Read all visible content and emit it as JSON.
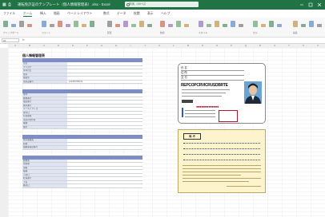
{
  "titlebar": {
    "autosave": "自動保存",
    "doc_title": "運転免許証のテンプレート（個人情報管理表）.xlsx - Excel",
    "search_placeholder": "検索（Alt+Q）"
  },
  "menu": {
    "items": [
      "ファイル",
      "ホーム",
      "挿入",
      "描画",
      "ページ レイアウト",
      "数式",
      "データ",
      "校閲",
      "表示",
      "ヘルプ"
    ],
    "active_index": 1
  },
  "ribbon": {
    "groups": [
      "クリップボード",
      "フォント",
      "配置",
      "数値",
      "スタイル",
      "セル",
      "編集"
    ]
  },
  "formula_bar": {
    "name_box": "A1",
    "fx": "fx"
  },
  "columns": [
    "A",
    "B",
    "C",
    "D",
    "E",
    "F",
    "G",
    "H",
    "I",
    "J",
    "K",
    "L",
    "M",
    "N",
    "O",
    "P",
    "Q",
    "R",
    "S",
    "T",
    "U",
    "V"
  ],
  "form": {
    "title": "個人情報管理表",
    "sections": [
      {
        "rows": [
          {
            "k": "氏名",
            "v": ""
          },
          {
            "k": "フリガナ",
            "v": ""
          },
          {
            "k": "生年月日",
            "v": ""
          },
          {
            "k": "性別",
            "v": ""
          },
          {
            "k": "血液型",
            "v": ""
          },
          {
            "k": "免許証番号",
            "v": "123456789012"
          }
        ]
      },
      {
        "rows": [
          {
            "k": "住所",
            "v": ""
          },
          {
            "k": "郵便番号",
            "v": ""
          },
          {
            "k": "電話番号",
            "v": ""
          },
          {
            "k": "携帯番号",
            "v": ""
          },
          {
            "k": "メールアドレス",
            "v": ""
          },
          {
            "k": "交付日",
            "v": ""
          },
          {
            "k": "有効期限",
            "v": ""
          },
          {
            "k": "免許の条件等",
            "v": ""
          },
          {
            "k": "種類",
            "v": ""
          },
          {
            "k": "備考",
            "v": ""
          }
        ]
      },
      {
        "rows": [
          {
            "k": "緊急連絡先",
            "v": ""
          },
          {
            "k": "続柄",
            "v": ""
          },
          {
            "k": "連絡先電話番号",
            "v": ""
          }
        ]
      },
      {
        "rows": [
          {
            "k": "勤務先",
            "v": ""
          },
          {
            "k": "所在地",
            "v": ""
          },
          {
            "k": "部署",
            "v": ""
          },
          {
            "k": "役職",
            "v": ""
          },
          {
            "k": "入社日",
            "v": ""
          },
          {
            "k": "社員番号",
            "v": ""
          },
          {
            "k": "上長",
            "v": ""
          },
          {
            "k": "確認日",
            "v": ""
          }
        ]
      }
    ]
  },
  "license_front": {
    "name_label": "氏 名",
    "address_label": "住 所",
    "issue_label": "交 付",
    "big_name": "REPCOPCRVICRUSDBRTE",
    "dots": "●●●●●●●●●●●●●",
    "number_prefix": "第"
  },
  "license_back": {
    "header": "備 考"
  },
  "colors": {
    "excel_green": "#217346",
    "section_header": "#7d8ec4",
    "key_cell": "#dfe4f2",
    "license_back": "#fdf3cc",
    "license_red": "#b0152a"
  }
}
